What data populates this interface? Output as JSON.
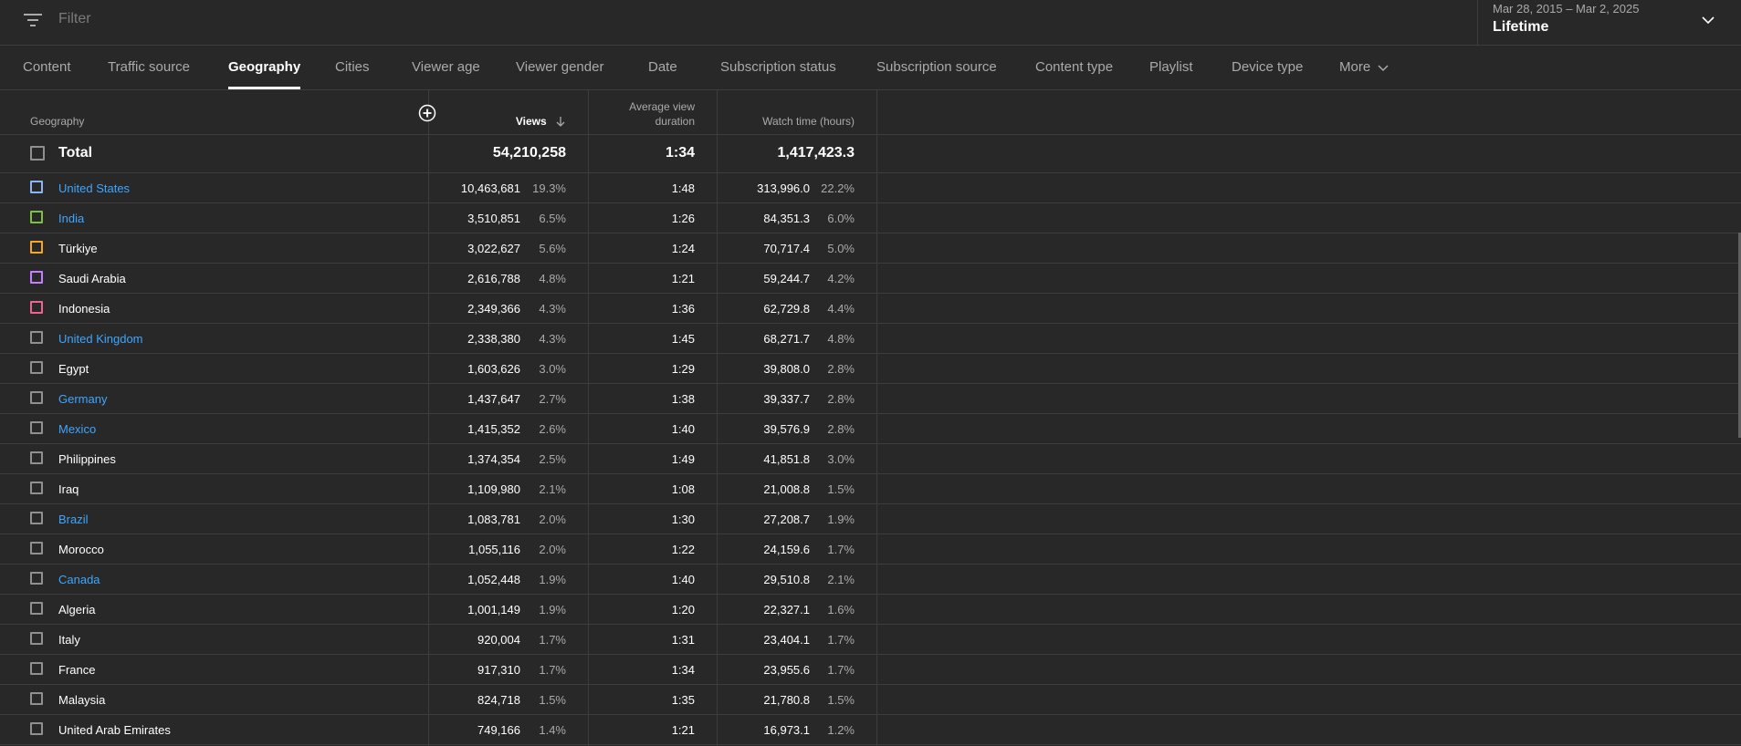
{
  "filter": {
    "placeholder": "Filter"
  },
  "date": {
    "range": "Mar 28, 2015 – Mar 2, 2025",
    "period": "Lifetime"
  },
  "tabs": [
    {
      "label": "Content"
    },
    {
      "label": "Traffic source"
    },
    {
      "label": "Geography",
      "active": true
    },
    {
      "label": "Cities"
    },
    {
      "label": "Viewer age"
    },
    {
      "label": "Viewer gender"
    },
    {
      "label": "Date"
    },
    {
      "label": "Subscription status"
    },
    {
      "label": "Subscription source"
    },
    {
      "label": "Content type"
    },
    {
      "label": "Playlist"
    },
    {
      "label": "Device type"
    },
    {
      "label": "More"
    }
  ],
  "table": {
    "headers": {
      "geography": "Geography",
      "views": "Views",
      "avd_line1": "Average view",
      "avd_line2": "duration",
      "watch": "Watch time (hours)"
    },
    "total": {
      "label": "Total",
      "views": "54,210,258",
      "avd": "1:34",
      "watch": "1,417,423.3"
    },
    "rows": [
      {
        "country": "United States",
        "link": true,
        "color": "#8ab4f8",
        "views": "10,463,681",
        "vpct": "19.3%",
        "avd": "1:48",
        "watch": "313,996.0",
        "wpct": "22.2%"
      },
      {
        "country": "India",
        "link": true,
        "color": "#7cc142",
        "views": "3,510,851",
        "vpct": "6.5%",
        "avd": "1:26",
        "watch": "84,351.3",
        "wpct": "6.0%"
      },
      {
        "country": "Türkiye",
        "link": false,
        "color": "#f5a623",
        "views": "3,022,627",
        "vpct": "5.6%",
        "avd": "1:24",
        "watch": "70,717.4",
        "wpct": "5.0%"
      },
      {
        "country": "Saudi Arabia",
        "link": false,
        "color": "#c77dff",
        "views": "2,616,788",
        "vpct": "4.8%",
        "avd": "1:21",
        "watch": "59,244.7",
        "wpct": "4.2%"
      },
      {
        "country": "Indonesia",
        "link": false,
        "color": "#f06292",
        "views": "2,349,366",
        "vpct": "4.3%",
        "avd": "1:36",
        "watch": "62,729.8",
        "wpct": "4.4%"
      },
      {
        "country": "United Kingdom",
        "link": true,
        "color": "",
        "views": "2,338,380",
        "vpct": "4.3%",
        "avd": "1:45",
        "watch": "68,271.7",
        "wpct": "4.8%"
      },
      {
        "country": "Egypt",
        "link": false,
        "color": "",
        "views": "1,603,626",
        "vpct": "3.0%",
        "avd": "1:29",
        "watch": "39,808.0",
        "wpct": "2.8%"
      },
      {
        "country": "Germany",
        "link": true,
        "color": "",
        "views": "1,437,647",
        "vpct": "2.7%",
        "avd": "1:38",
        "watch": "39,337.7",
        "wpct": "2.8%"
      },
      {
        "country": "Mexico",
        "link": true,
        "color": "",
        "views": "1,415,352",
        "vpct": "2.6%",
        "avd": "1:40",
        "watch": "39,576.9",
        "wpct": "2.8%"
      },
      {
        "country": "Philippines",
        "link": false,
        "color": "",
        "views": "1,374,354",
        "vpct": "2.5%",
        "avd": "1:49",
        "watch": "41,851.8",
        "wpct": "3.0%"
      },
      {
        "country": "Iraq",
        "link": false,
        "color": "",
        "views": "1,109,980",
        "vpct": "2.1%",
        "avd": "1:08",
        "watch": "21,008.8",
        "wpct": "1.5%"
      },
      {
        "country": "Brazil",
        "link": true,
        "color": "",
        "views": "1,083,781",
        "vpct": "2.0%",
        "avd": "1:30",
        "watch": "27,208.7",
        "wpct": "1.9%"
      },
      {
        "country": "Morocco",
        "link": false,
        "color": "",
        "views": "1,055,116",
        "vpct": "2.0%",
        "avd": "1:22",
        "watch": "24,159.6",
        "wpct": "1.7%"
      },
      {
        "country": "Canada",
        "link": true,
        "color": "",
        "views": "1,052,448",
        "vpct": "1.9%",
        "avd": "1:40",
        "watch": "29,510.8",
        "wpct": "2.1%"
      },
      {
        "country": "Algeria",
        "link": false,
        "color": "",
        "views": "1,001,149",
        "vpct": "1.9%",
        "avd": "1:20",
        "watch": "22,327.1",
        "wpct": "1.6%"
      },
      {
        "country": "Italy",
        "link": false,
        "color": "",
        "views": "920,004",
        "vpct": "1.7%",
        "avd": "1:31",
        "watch": "23,404.1",
        "wpct": "1.7%"
      },
      {
        "country": "France",
        "link": false,
        "color": "",
        "views": "917,310",
        "vpct": "1.7%",
        "avd": "1:34",
        "watch": "23,955.6",
        "wpct": "1.7%"
      },
      {
        "country": "Malaysia",
        "link": false,
        "color": "",
        "views": "824,718",
        "vpct": "1.5%",
        "avd": "1:35",
        "watch": "21,780.8",
        "wpct": "1.5%"
      },
      {
        "country": "United Arab Emirates",
        "link": false,
        "color": "",
        "views": "749,166",
        "vpct": "1.4%",
        "avd": "1:21",
        "watch": "16,973.1",
        "wpct": "1.2%"
      }
    ]
  },
  "icons": {
    "filter": "filter-icon",
    "chevron": "chevron-down-icon",
    "sort": "arrow-down-icon",
    "add_column": "add-circle-icon"
  }
}
